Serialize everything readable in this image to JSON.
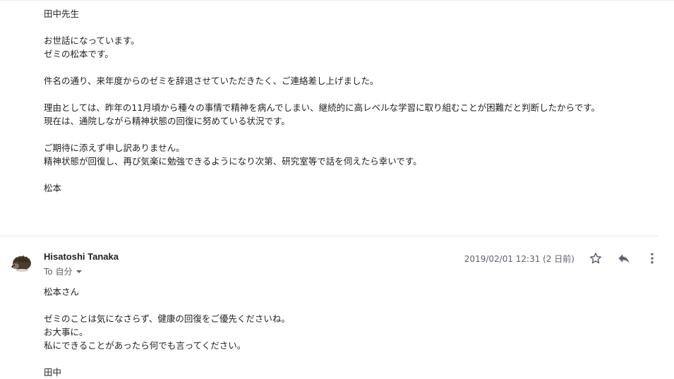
{
  "message1": {
    "lines": [
      "田中先生",
      "",
      "お世話になっています。",
      "ゼミの松本です。",
      "",
      "件名の通り、来年度からのゼミを辞退させていただきたく、ご連絡差し上げました。",
      "",
      "理由としては、昨年の11月頃から種々の事情で精神を病んでしまい、継続的に高レベルな学習に取り組むことが困難だと判断したからです。",
      "現在は、通院しながら精神状態の回復に努めている状況です。",
      "",
      "ご期待に添えず申し訳ありません。",
      "精神状態が回復し、再び気楽に勉強できるようになり次第、研究室等で話を伺えたら幸いです。",
      "",
      "松本"
    ]
  },
  "message2": {
    "sender": "Hisatoshi Tanaka",
    "to_label": "To 自分",
    "date": "2019/02/01 12:31 (2 日前)",
    "lines": [
      "松本さん",
      "",
      "ゼミのことは気になさらず、健康の回復をご優先くださいね。",
      "お大事に。",
      "私にできることがあったら何でも言ってください。",
      "",
      "田中"
    ]
  },
  "icons": {
    "star": "star-icon",
    "reply": "reply-icon",
    "more": "more-vert-icon",
    "avatar": "hedgehog-avatar"
  },
  "colors": {
    "text": "#222222",
    "secondary": "#5f6368",
    "divider": "#e6e6e6"
  }
}
